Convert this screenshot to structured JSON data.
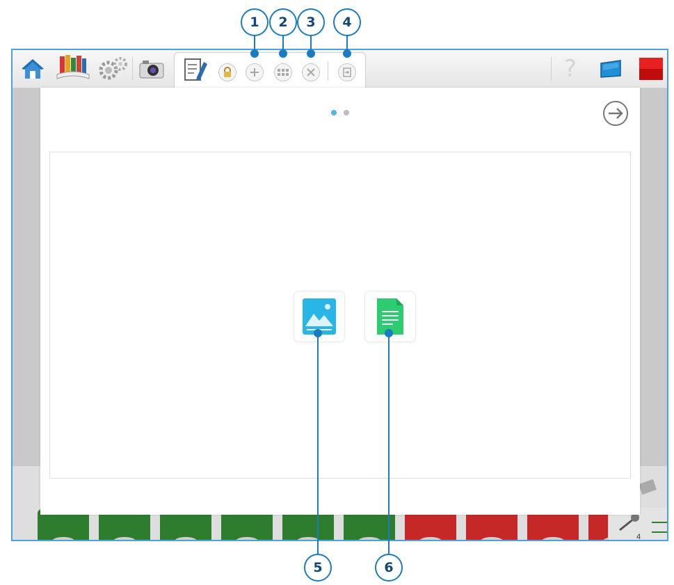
{
  "callouts": {
    "c1": "1",
    "c2": "2",
    "c3": "3",
    "c4": "4",
    "c5": "5",
    "c6": "6"
  },
  "toolbar": {
    "help_label": "?"
  },
  "tray": {
    "counter": "4"
  },
  "pager": {
    "active_page": 1,
    "page_count": 2
  },
  "colors": {
    "callout_blue": "#1a7bbf",
    "frame_blue": "#4aa3df",
    "image_tile": "#29b6e6",
    "text_tile": "#2ecc71",
    "stop_red": "#e01010",
    "block_green": "#2e7d2e",
    "block_red": "#c62828"
  }
}
